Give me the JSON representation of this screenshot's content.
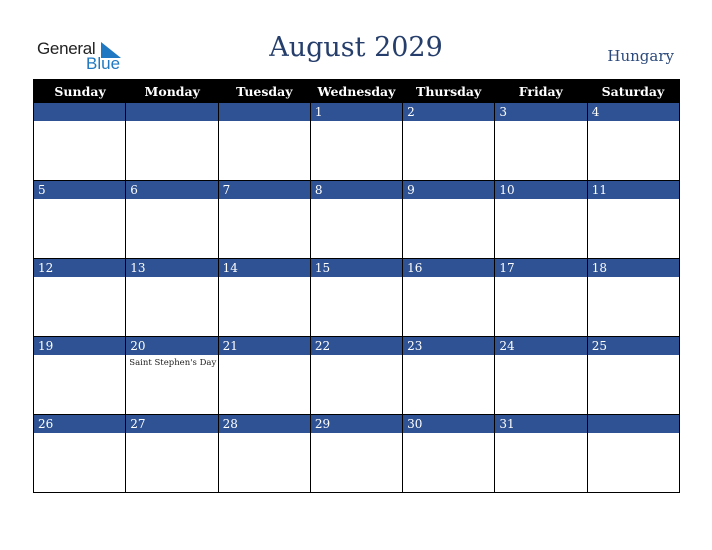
{
  "header": {
    "logo_text_1": "General",
    "logo_text_2": "Blue",
    "title": "August 2029",
    "country": "Hungary"
  },
  "colors": {
    "band": "#2e5293",
    "title": "#263e6b",
    "logo_blue": "#1f78c1"
  },
  "weekdays": [
    "Sunday",
    "Monday",
    "Tuesday",
    "Wednesday",
    "Thursday",
    "Friday",
    "Saturday"
  ],
  "weeks": [
    [
      {
        "d": ""
      },
      {
        "d": ""
      },
      {
        "d": ""
      },
      {
        "d": "1"
      },
      {
        "d": "2"
      },
      {
        "d": "3"
      },
      {
        "d": "4"
      }
    ],
    [
      {
        "d": "5"
      },
      {
        "d": "6"
      },
      {
        "d": "7"
      },
      {
        "d": "8"
      },
      {
        "d": "9"
      },
      {
        "d": "10"
      },
      {
        "d": "11"
      }
    ],
    [
      {
        "d": "12"
      },
      {
        "d": "13"
      },
      {
        "d": "14"
      },
      {
        "d": "15"
      },
      {
        "d": "16"
      },
      {
        "d": "17"
      },
      {
        "d": "18"
      }
    ],
    [
      {
        "d": "19"
      },
      {
        "d": "20",
        "e": "Saint Stephen's Day"
      },
      {
        "d": "21"
      },
      {
        "d": "22"
      },
      {
        "d": "23"
      },
      {
        "d": "24"
      },
      {
        "d": "25"
      }
    ],
    [
      {
        "d": "26"
      },
      {
        "d": "27"
      },
      {
        "d": "28"
      },
      {
        "d": "29"
      },
      {
        "d": "30"
      },
      {
        "d": "31"
      },
      {
        "d": ""
      }
    ]
  ]
}
